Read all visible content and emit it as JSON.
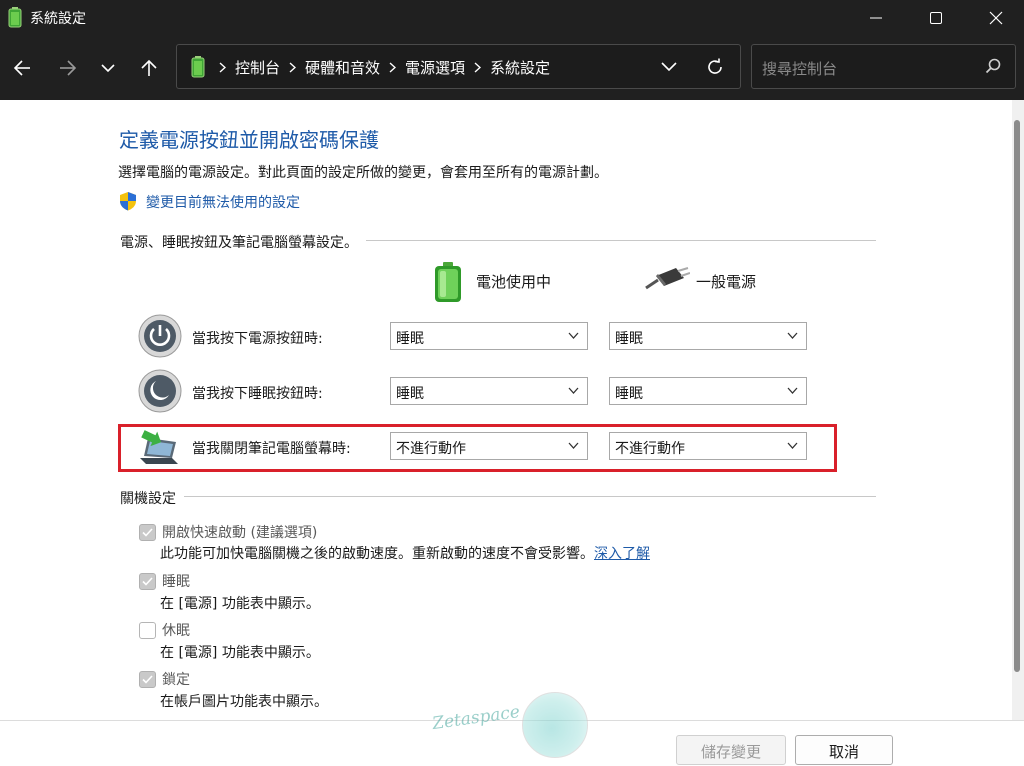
{
  "window": {
    "title": "系統設定"
  },
  "nav": {
    "breadcrumb": [
      "控制台",
      "硬體和音效",
      "電源選項",
      "系統設定"
    ]
  },
  "search": {
    "placeholder": "搜尋控制台"
  },
  "page": {
    "title": "定義電源按鈕並開啟密碼保護",
    "description": "選擇電腦的電源設定。對此頁面的設定所做的變更，會套用至所有的電源計劃。",
    "unavailable_link": "變更目前無法使用的設定"
  },
  "power_buttons": {
    "group_label": "電源、睡眠按鈕及筆記電腦螢幕設定。",
    "column_battery": "電池使用中",
    "column_plugged": "一般電源",
    "rows": [
      {
        "label": "當我按下電源按鈕時:",
        "battery": "睡眠",
        "plugged": "睡眠",
        "icon": "power-button-icon"
      },
      {
        "label": "當我按下睡眠按鈕時:",
        "battery": "睡眠",
        "plugged": "睡眠",
        "icon": "sleep-button-icon"
      },
      {
        "label": "當我關閉筆記電腦螢幕時:",
        "battery": "不進行動作",
        "plugged": "不進行動作",
        "icon": "laptop-lid-icon"
      }
    ]
  },
  "shutdown": {
    "group_label": "關機設定",
    "items": [
      {
        "label": "開啟快速啟動 (建議選項)",
        "desc": "此功能可加快電腦關機之後的啟動速度。重新啟動的速度不會受影響。",
        "link": "深入了解",
        "checked": true
      },
      {
        "label": "睡眠",
        "desc": "在 [電源] 功能表中顯示。",
        "checked": true
      },
      {
        "label": "休眠",
        "desc": "在 [電源] 功能表中顯示。",
        "checked": false
      },
      {
        "label": "鎖定",
        "desc": "在帳戶圖片功能表中顯示。",
        "checked": true
      }
    ]
  },
  "footer": {
    "save": "儲存變更",
    "cancel": "取消"
  },
  "watermark": {
    "text": "Zetaspace"
  },
  "colors": {
    "title_bar": "#202020",
    "link": "#1e5aa8",
    "highlight": "#d9202a"
  }
}
